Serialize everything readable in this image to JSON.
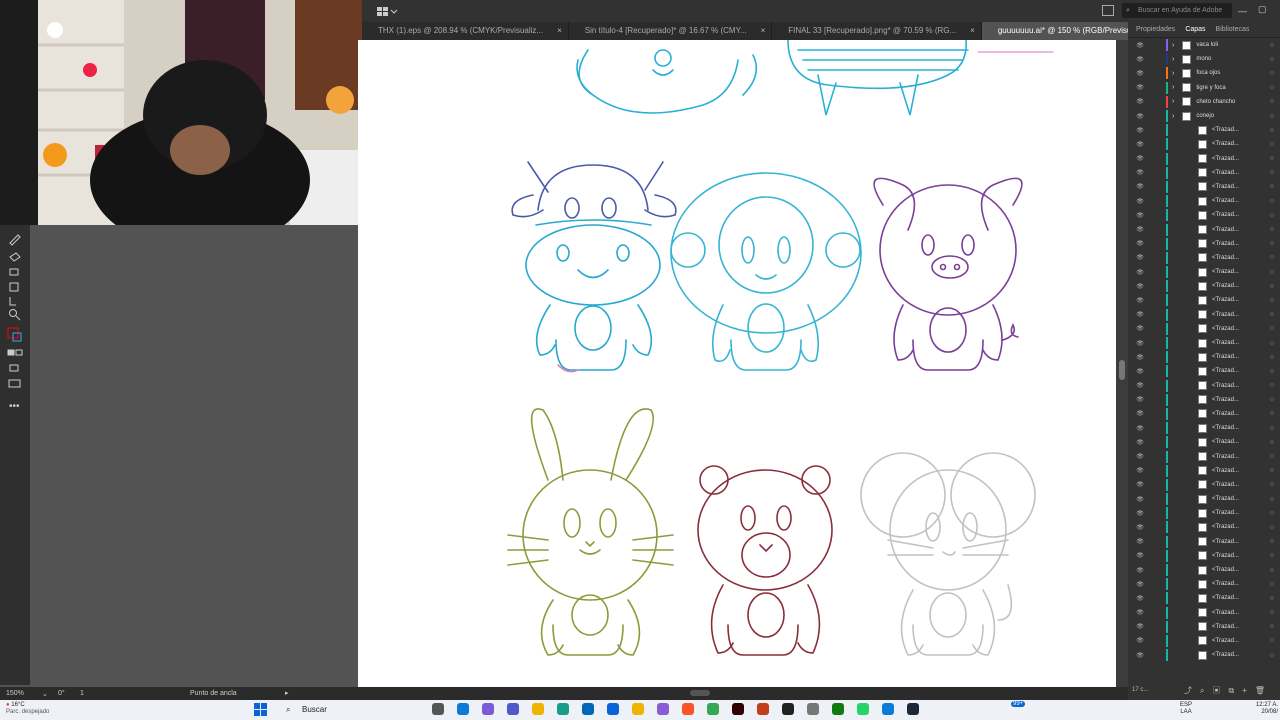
{
  "app": {
    "search_placeholder": "Buscar en Ayuda de Adobe",
    "tabs": [
      {
        "label": "THX (1).eps @ 208.94 % (CMYK/Previsualiz..."
      },
      {
        "label": "Sin título-4 [Recuperado]* @ 16.67 % (CMY..."
      },
      {
        "label": "FINAL 33 [Recuperado].png* @ 70.59 % (RG..."
      },
      {
        "label": "guuuuuuu.ai* @ 150 % (RGB/Previsualizar)"
      }
    ],
    "tab_close": "×"
  },
  "panel": {
    "tabs": [
      "Propiedades",
      "Capas",
      "Bibliotecas"
    ],
    "layers": [
      {
        "name": "vaca loli",
        "color": "#8b5cf6"
      },
      {
        "name": "mono",
        "color": "#1e3a8a"
      },
      {
        "name": "foca ojos",
        "color": "#f97316"
      },
      {
        "name": "tigre y foca",
        "color": "#10b981"
      },
      {
        "name": "cheto chancho",
        "color": "#ef4444"
      },
      {
        "name": "conejo",
        "color": "#14b8a6"
      }
    ],
    "sublayer_label": "<Trazad...",
    "sublayer_count": 38,
    "footer_count": "17 c..."
  },
  "status": {
    "zoom": "150%",
    "angle": "0°",
    "artboard": "1",
    "tool": "Punto de ancla"
  },
  "taskbar": {
    "weather_temp": "16°C",
    "weather_desc": "Parc. despejado",
    "search_label": "Buscar",
    "lang": "ESP",
    "lang_sub": "LAA",
    "time": "12:27 A.",
    "date": "20/08/",
    "notif": "99+"
  },
  "colors": {
    "cow": "#27a9d0",
    "monkey": "#35b5d4",
    "pig": "#7a3f98",
    "rabbit": "#8e9a3a",
    "bear": "#8a2e3c",
    "mouse": "#c2c2c2",
    "accent": "#31a8ff"
  }
}
